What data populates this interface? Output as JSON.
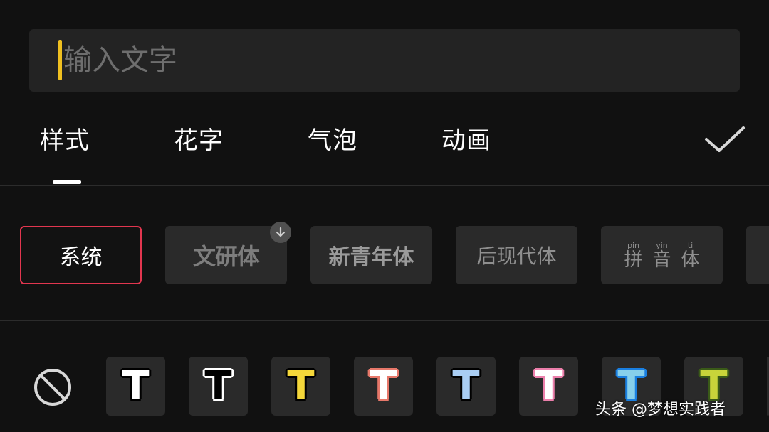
{
  "input": {
    "placeholder": "输入文字",
    "value": ""
  },
  "tabs": [
    {
      "label": "样式",
      "active": true
    },
    {
      "label": "花字",
      "active": false
    },
    {
      "label": "气泡",
      "active": false
    },
    {
      "label": "动画",
      "active": false
    }
  ],
  "fonts": [
    {
      "label": "系统",
      "selected": true
    },
    {
      "label": "文研体",
      "downloadable": true
    },
    {
      "label": "新青年体"
    },
    {
      "label": "后现代体"
    },
    {
      "label": "拼音体",
      "pinyin": [
        "pin",
        "yin",
        "ti"
      ],
      "chars": [
        "拼",
        "音",
        "体"
      ]
    }
  ],
  "text_styles": [
    {
      "glyph": "T",
      "fill": "#ffffff",
      "stroke": "#000000"
    },
    {
      "glyph": "T",
      "fill": "#000000",
      "stroke": "#ffffff"
    },
    {
      "glyph": "T",
      "fill": "#f4d73a",
      "stroke": "#000000"
    },
    {
      "glyph": "T",
      "fill": "#ffffff",
      "stroke": "#e7786a"
    },
    {
      "glyph": "T",
      "fill": "#a9cdf3",
      "stroke": "#000000"
    },
    {
      "glyph": "T",
      "fill": "#ffffff",
      "stroke": "#ec7fab"
    },
    {
      "glyph": "T",
      "fill": "#87cfeb",
      "stroke": "#1a7fe0"
    },
    {
      "glyph": "T",
      "fill": "#c8d43a",
      "stroke": "#3a5a18"
    }
  ],
  "watermark": "头条 @梦想实践者",
  "colors": {
    "accent_caret": "#f0c020",
    "selected_border": "#e2364f",
    "background": "#111111"
  }
}
